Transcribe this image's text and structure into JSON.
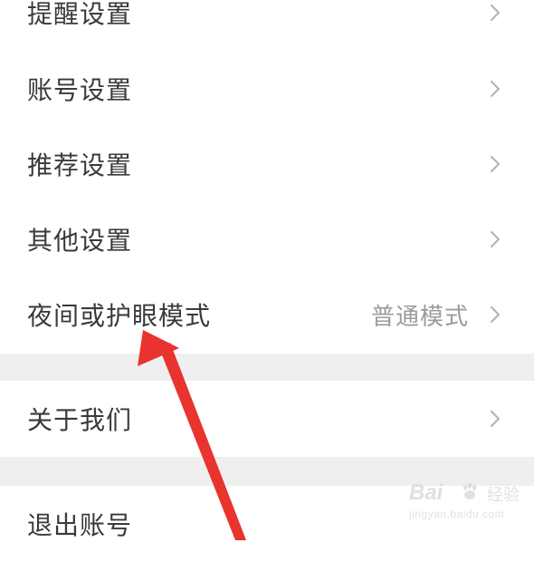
{
  "settings_list": {
    "items": [
      {
        "label": "提醒设置",
        "value": ""
      },
      {
        "label": "账号设置",
        "value": ""
      },
      {
        "label": "推荐设置",
        "value": ""
      },
      {
        "label": "其他设置",
        "value": ""
      },
      {
        "label": "夜间或护眼模式",
        "value": "普通模式"
      }
    ],
    "about": {
      "label": "关于我们"
    },
    "logout": {
      "label": "退出账号"
    }
  },
  "icons": {
    "chevron": "chevron-right-icon",
    "arrow": "red-annotation-arrow"
  },
  "colors": {
    "background": "#ffffff",
    "divider_band": "#efefef",
    "label_text": "#3a3a3a",
    "value_text": "#9b9b9b",
    "chevron": "#b5b5b5",
    "arrow": "#e8332f"
  },
  "watermark": {
    "brand": "Bai",
    "brand_cn": "经验",
    "url": "jingyan.baidu.com"
  }
}
